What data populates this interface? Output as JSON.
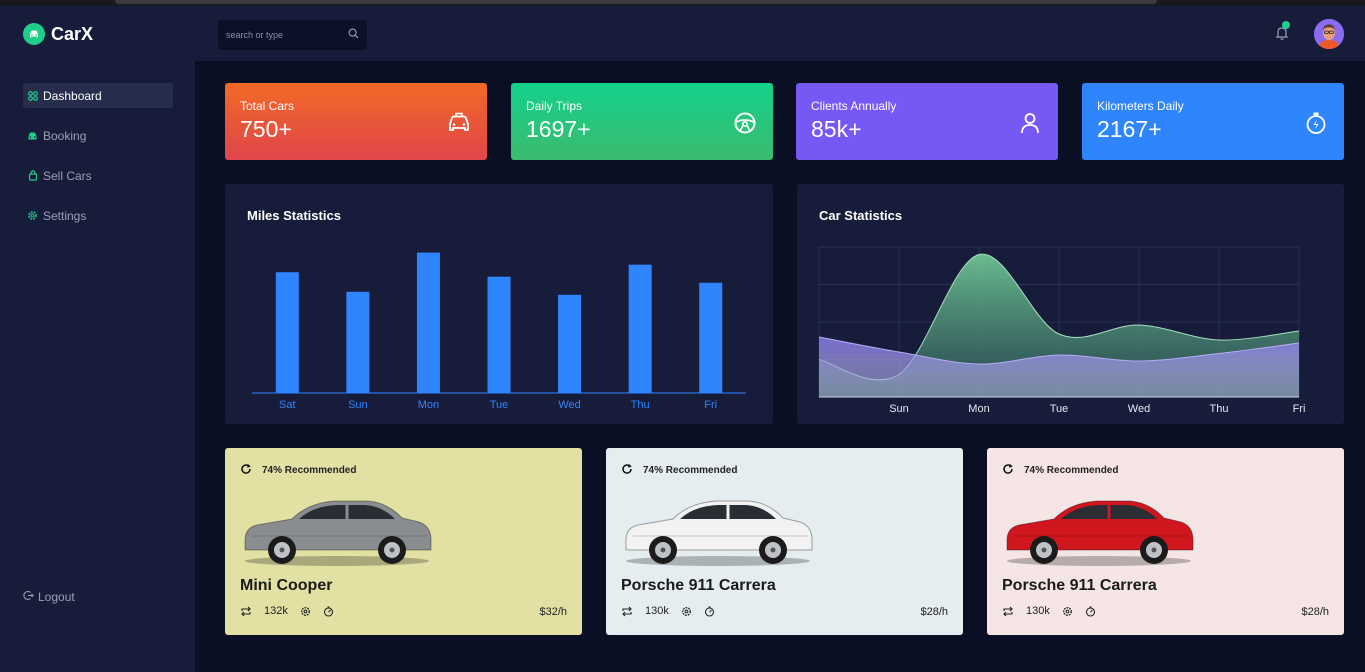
{
  "app": {
    "name": "CarX"
  },
  "search": {
    "placeholder": "search or type"
  },
  "sidebar": {
    "items": [
      {
        "label": "Dashboard",
        "icon": "grid-icon",
        "active": true
      },
      {
        "label": "Booking",
        "icon": "car-icon",
        "active": false
      },
      {
        "label": "Sell Cars",
        "icon": "bag-icon",
        "active": false
      },
      {
        "label": "Settings",
        "icon": "gear-icon",
        "active": false
      }
    ],
    "logout": "Logout"
  },
  "stats": [
    {
      "label": "Total Cars",
      "value": "750+",
      "icon": "taxi-icon"
    },
    {
      "label": "Daily Trips",
      "value": "1697+",
      "icon": "steering-wheel-icon"
    },
    {
      "label": "Clients Annually",
      "value": "85k+",
      "icon": "user-icon"
    },
    {
      "label": "Kilometers Daily",
      "value": "2167+",
      "icon": "stopwatch-icon"
    }
  ],
  "miles": {
    "title": "Miles Statistics",
    "chart_data": {
      "type": "bar",
      "categories": [
        "Sat",
        "Sun",
        "Mon",
        "Tue",
        "Wed",
        "Thu",
        "Fri"
      ],
      "values": [
        80,
        67,
        93,
        77,
        65,
        85,
        73
      ],
      "ylim": [
        0,
        100
      ],
      "color": "#2f85fe"
    }
  },
  "carstats": {
    "title": "Car Statistics",
    "chart_data": {
      "type": "area",
      "categories": [
        "",
        "Sun",
        "Mon",
        "Tue",
        "Wed",
        "Thu",
        "Fri"
      ],
      "series": [
        {
          "values": [
            25,
            15,
            95,
            42,
            48,
            38,
            44
          ],
          "color": "#5fae82"
        },
        {
          "values": [
            40,
            30,
            22,
            28,
            24,
            29,
            36
          ],
          "color": "#8a7be8"
        }
      ],
      "ylim": [
        0,
        100
      ],
      "grid": true
    }
  },
  "cars": [
    {
      "recommended": "74% Recommended",
      "name": "Mini Cooper",
      "mileage": "132k",
      "price": "$32/h",
      "color": "#8a8d90"
    },
    {
      "recommended": "74% Recommended",
      "name": "Porsche 911 Carrera",
      "mileage": "130k",
      "price": "$28/h",
      "color": "#f2f2f2"
    },
    {
      "recommended": "74% Recommended",
      "name": "Porsche 911 Carrera",
      "mileage": "130k",
      "price": "$28/h",
      "color": "#d0161e"
    }
  ]
}
